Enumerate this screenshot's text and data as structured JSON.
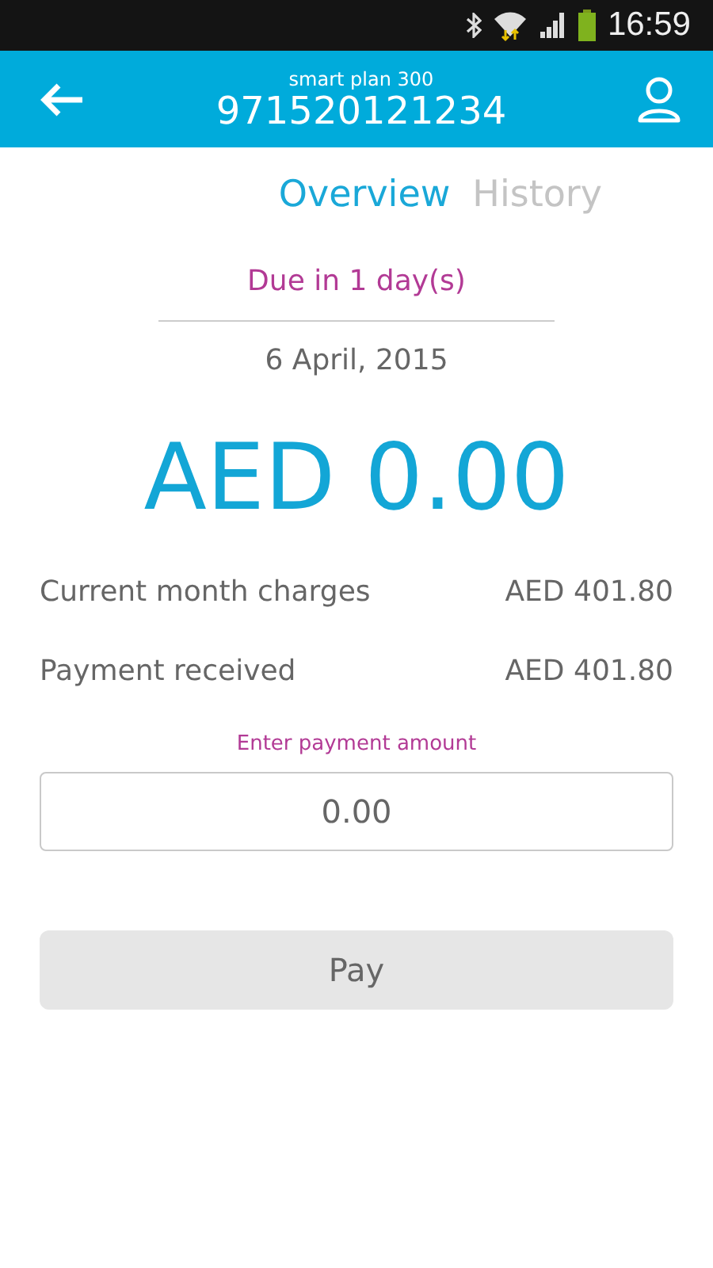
{
  "status_bar": {
    "time": "16:59"
  },
  "header": {
    "plan": "smart plan 300",
    "number": "971520121234"
  },
  "tabs": [
    {
      "label": "Overview",
      "selected": true
    },
    {
      "label": "History",
      "selected": false
    }
  ],
  "due": "Due in 1 day(s)",
  "date": "6 April, 2015",
  "balance": "AED 0.00",
  "charges": [
    {
      "label": "Current month charges",
      "amount": "AED 401.80"
    },
    {
      "label": "Payment received",
      "amount": "AED 401.80"
    }
  ],
  "payment": {
    "label": "Enter payment amount",
    "placeholder": "0.00"
  },
  "pay_button": "Pay"
}
